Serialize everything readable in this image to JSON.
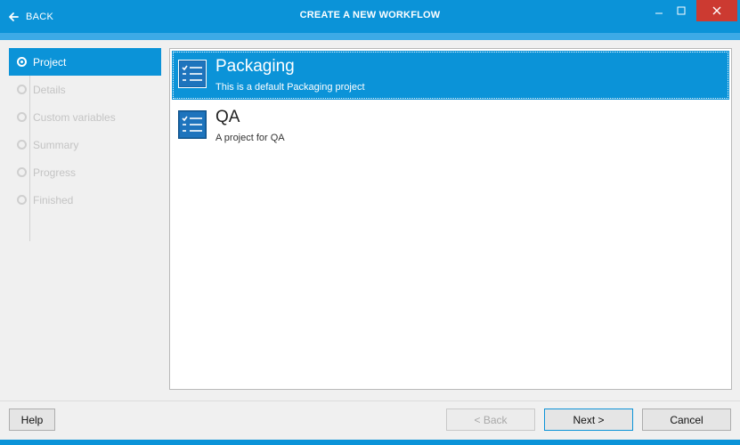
{
  "titlebar": {
    "back_label": "BACK",
    "title": "CREATE A NEW WORKFLOW",
    "minimize_glyph": "–",
    "close_glyph": "✕"
  },
  "steps": [
    {
      "label": "Project",
      "active": true
    },
    {
      "label": "Details",
      "active": false
    },
    {
      "label": "Custom variables",
      "active": false
    },
    {
      "label": "Summary",
      "active": false
    },
    {
      "label": "Progress",
      "active": false
    },
    {
      "label": "Finished",
      "active": false
    }
  ],
  "projects": [
    {
      "name": "Packaging",
      "description": "This is a default Packaging project",
      "selected": true,
      "icon": "checklist-icon"
    },
    {
      "name": "QA",
      "description": "A project for QA",
      "selected": false,
      "icon": "checklist-icon"
    }
  ],
  "footer": {
    "help_label": "Help",
    "back_label": "< Back",
    "next_label": "Next >",
    "cancel_label": "Cancel"
  },
  "colors": {
    "accent": "#0b93d8",
    "accent_light": "#3daae6",
    "close": "#cc3a31",
    "disabled_text": "#c4c4c4"
  }
}
